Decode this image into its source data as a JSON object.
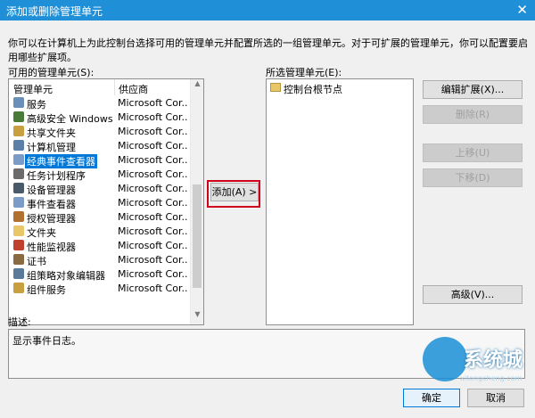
{
  "window": {
    "title": "添加或删除管理单元",
    "close_glyph": "✕"
  },
  "description": "你可以在计算机上为此控制台选择可用的管理单元并配置所选的一组管理单元。对于可扩展的管理单元，你可以配置要启用哪些扩展项。",
  "available": {
    "label": "可用的管理单元(S):",
    "columns": {
      "name": "管理单元",
      "vendor": "供应商"
    },
    "rows": [
      {
        "name": "服务",
        "vendor": "Microsoft Cor...",
        "icon": "services-icon",
        "color": "#6a8fb8"
      },
      {
        "name": "高级安全 Windows 防...",
        "vendor": "Microsoft Cor...",
        "icon": "firewall-icon",
        "color": "#4a7a3a"
      },
      {
        "name": "共享文件夹",
        "vendor": "Microsoft Cor...",
        "icon": "shared-folder-icon",
        "color": "#c9a040"
      },
      {
        "name": "计算机管理",
        "vendor": "Microsoft Cor...",
        "icon": "computer-management-icon",
        "color": "#5b7fa6"
      },
      {
        "name": "经典事件查看器",
        "vendor": "Microsoft Cor...",
        "icon": "event-viewer-icon",
        "color": "#7a9cc6",
        "selected": true
      },
      {
        "name": "任务计划程序",
        "vendor": "Microsoft Cor...",
        "icon": "task-scheduler-icon",
        "color": "#6b6b6b"
      },
      {
        "name": "设备管理器",
        "vendor": "Microsoft Cor...",
        "icon": "device-manager-icon",
        "color": "#4a5a6a"
      },
      {
        "name": "事件查看器",
        "vendor": "Microsoft Cor...",
        "icon": "event-viewer-icon",
        "color": "#7a9cc6"
      },
      {
        "name": "授权管理器",
        "vendor": "Microsoft Cor...",
        "icon": "authorization-manager-icon",
        "color": "#b07030"
      },
      {
        "name": "文件夹",
        "vendor": "Microsoft Cor...",
        "icon": "folder-icon",
        "color": "#e8c66a"
      },
      {
        "name": "性能监视器",
        "vendor": "Microsoft Cor...",
        "icon": "performance-monitor-icon",
        "color": "#c04030"
      },
      {
        "name": "证书",
        "vendor": "Microsoft Cor...",
        "icon": "certificates-icon",
        "color": "#8a6a40"
      },
      {
        "name": "组策略对象编辑器",
        "vendor": "Microsoft Cor...",
        "icon": "group-policy-icon",
        "color": "#5a7a9a"
      },
      {
        "name": "组件服务",
        "vendor": "Microsoft Cor...",
        "icon": "component-services-icon",
        "color": "#c9a040"
      }
    ]
  },
  "add_button": "添加(A) >",
  "selected": {
    "label": "所选管理单元(E):",
    "items": [
      {
        "name": "控制台根节点",
        "icon": "folder-icon"
      }
    ]
  },
  "side_buttons": {
    "edit_extensions": "编辑扩展(X)...",
    "remove": "删除(R)",
    "move_up": "上移(U)",
    "move_down": "下移(D)",
    "advanced": "高级(V)..."
  },
  "description_box": {
    "label": "描述:",
    "text": "显示事件日志。"
  },
  "footer": {
    "ok": "确定",
    "cancel": "取消"
  },
  "watermark": {
    "text": "系统城",
    "sub": "xitongcheng.com"
  }
}
